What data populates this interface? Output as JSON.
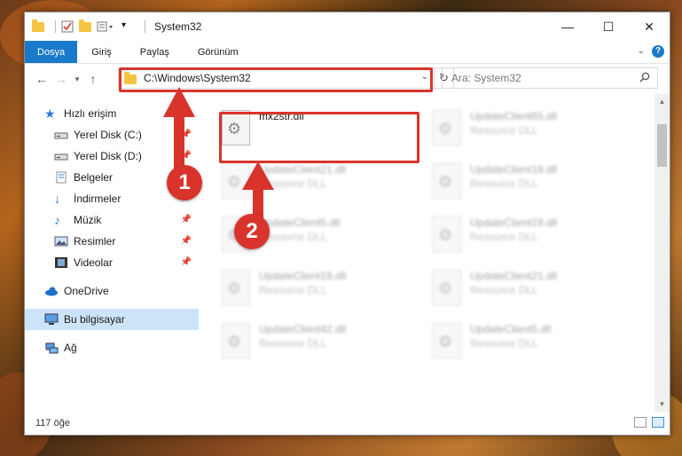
{
  "window": {
    "title": "System32",
    "controls": {
      "minimize": "—",
      "maximize": "☐",
      "close": "✕"
    }
  },
  "ribbon": {
    "tabs": [
      {
        "label": "Dosya",
        "active": true
      },
      {
        "label": "Giriş"
      },
      {
        "label": "Paylaş"
      },
      {
        "label": "Görünüm"
      }
    ],
    "expand_icon": "chevron-down",
    "help_icon": "?"
  },
  "address": {
    "path": "C:\\Windows\\System32",
    "search_placeholder": "Ara: System32"
  },
  "sidebar": {
    "items": [
      {
        "label": "Hızlı erişim",
        "icon": "star-icon",
        "indent": false
      },
      {
        "label": "Yerel Disk (C:)",
        "icon": "drive-icon",
        "indent": true,
        "pinned": true
      },
      {
        "label": "Yerel Disk (D:)",
        "icon": "drive-icon",
        "indent": true,
        "pinned": true
      },
      {
        "label": "Belgeler",
        "icon": "documents-icon",
        "indent": true,
        "pinned": true
      },
      {
        "label": "İndirmeler",
        "icon": "download-icon",
        "indent": true,
        "pinned": true
      },
      {
        "label": "Müzik",
        "icon": "music-icon",
        "indent": true,
        "pinned": true
      },
      {
        "label": "Resimler",
        "icon": "pictures-icon",
        "indent": true,
        "pinned": true
      },
      {
        "label": "Videolar",
        "icon": "video-icon",
        "indent": true,
        "pinned": true
      },
      {
        "label": "OneDrive",
        "icon": "cloud-icon",
        "indent": false
      },
      {
        "label": "Bu bilgisayar",
        "icon": "computer-icon",
        "indent": false,
        "selected": true
      },
      {
        "label": "Ağ",
        "icon": "network-icon",
        "indent": false
      }
    ]
  },
  "files": [
    {
      "name": "mx2str.dll",
      "type": "",
      "highlighted": true
    },
    {
      "name": "UpdateClient65.dll",
      "type": "Resource DLL"
    },
    {
      "name": "UpdateClient21.dll",
      "type": "Resource DLL"
    },
    {
      "name": "UpdateClient19.dll",
      "type": "Resource DLL"
    },
    {
      "name": "UpdateClient5.dll",
      "type": "Resource DLL"
    },
    {
      "name": "UpdateClient19.dll",
      "type": "Resource DLL"
    },
    {
      "name": "UpdateClient19.dll",
      "type": "Resource DLL"
    },
    {
      "name": "UpdateClient21.dll",
      "type": "Resource DLL"
    },
    {
      "name": "UpdateClient42.dll",
      "type": "Resource DLL"
    },
    {
      "name": "UpdateClient5.dll",
      "type": "Resource DLL"
    }
  ],
  "status": {
    "count": "117 öğe"
  },
  "annotations": {
    "badge1": "1",
    "badge2": "2",
    "color": "#d9342b"
  },
  "colors": {
    "accent": "#1979ca",
    "selection": "#cce4f7"
  }
}
